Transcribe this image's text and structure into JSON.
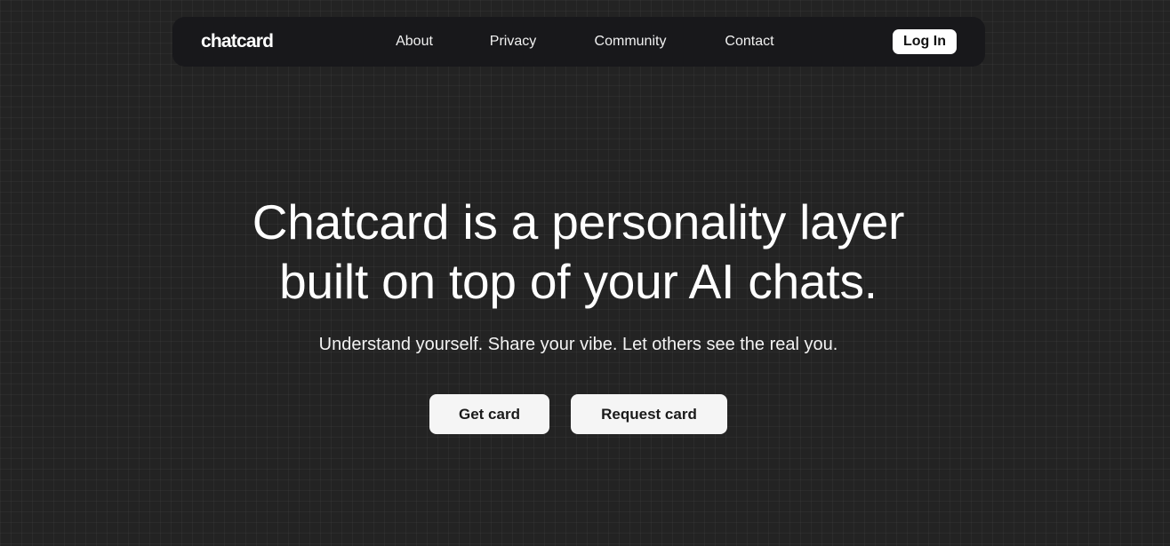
{
  "nav": {
    "brand": "chatcard",
    "links": [
      {
        "label": "About"
      },
      {
        "label": "Privacy"
      },
      {
        "label": "Community"
      },
      {
        "label": "Contact"
      }
    ],
    "login_label": "Log In"
  },
  "hero": {
    "headline_line1": "Chatcard is a personality layer",
    "headline_line2": "built on top of your AI chats.",
    "subtitle": "Understand yourself. Share your vibe. Let others see the real you.",
    "primary_cta": "Get card",
    "secondary_cta": "Request card"
  },
  "colors": {
    "background": "#232323",
    "navbar": "#18181b",
    "button": "#f5f5f5",
    "text": "#ffffff"
  }
}
